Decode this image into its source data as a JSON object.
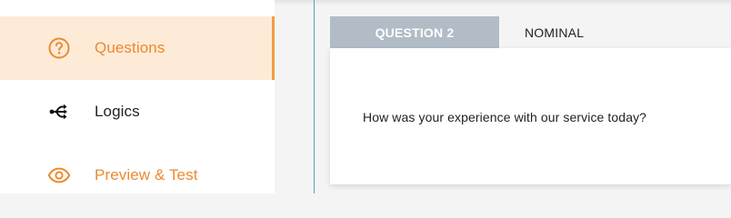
{
  "sidebar": {
    "items": [
      {
        "label": "Questions",
        "icon": "question-circle-icon",
        "active": true
      },
      {
        "label": "Logics",
        "icon": "branch-arrow-icon",
        "active": false
      },
      {
        "label": "Preview & Test",
        "icon": "eye-icon",
        "active": false
      }
    ]
  },
  "editor": {
    "question_tab": "QUESTION 2",
    "type_tab": "NOMINAL",
    "question_text": "How was your experience with our service today?"
  },
  "colors": {
    "accent": "#ec8a2f",
    "active_bg": "#fdebd8",
    "tab_bg": "#b1bcc6"
  }
}
